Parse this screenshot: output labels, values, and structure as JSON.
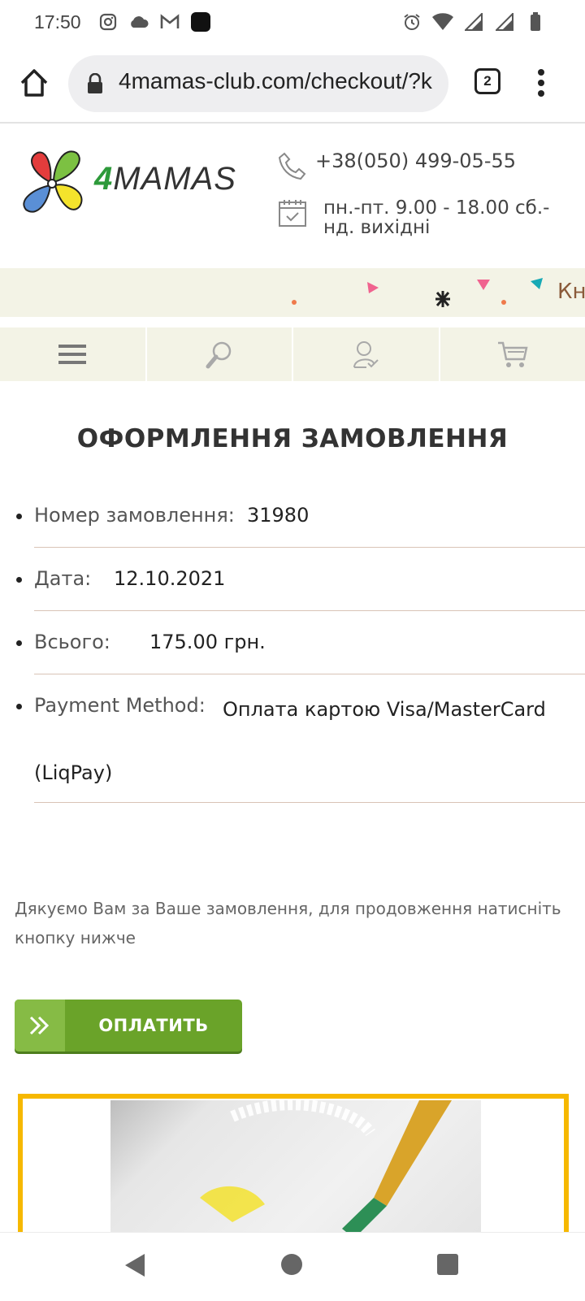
{
  "status_bar": {
    "time": "17:50",
    "left_icons": [
      "instagram-icon",
      "cloud-icon",
      "gmail-icon",
      "app-icon"
    ],
    "right_icons": [
      "alarm-icon",
      "wifi-icon",
      "signal-icon",
      "signal-icon",
      "battery-icon"
    ]
  },
  "browser": {
    "url": "4mamas-club.com/checkout/?k",
    "tab_count": "2"
  },
  "site_header": {
    "logo_text_four": "4",
    "logo_text_rest": "MAMAS",
    "phone": "+38(050) 499-05-55",
    "hours": "пн.-пт. 9.00 - 18.00 сб.-нд. вихідні"
  },
  "promo_strip": {
    "text": "Кн"
  },
  "nav": {
    "items": [
      "menu-icon",
      "search-icon",
      "account-icon",
      "cart-icon"
    ]
  },
  "page": {
    "title": "ОФОРМЛЕННЯ ЗАМОВЛЕННЯ"
  },
  "order": {
    "number_label": "Номер замовлення:",
    "number_value": "31980",
    "date_label": "Дата:",
    "date_value": "12.10.2021",
    "total_label": "Всього:",
    "total_value": "175.00 грн.",
    "payment_label": "Payment Method:",
    "payment_value_line1": "Оплата картою Visa/MasterCard",
    "payment_value_line2": "(LiqPay)"
  },
  "thanks_text": "Дякуємо Вам за Ваше замовлення, для продовження натисніть кнопку нижче",
  "pay_button": {
    "label": "ОПЛАТИТЬ"
  },
  "colors": {
    "pay_button": "#6aa329",
    "card_border": "#f6b800",
    "nav_background": "#f3f3e6"
  }
}
